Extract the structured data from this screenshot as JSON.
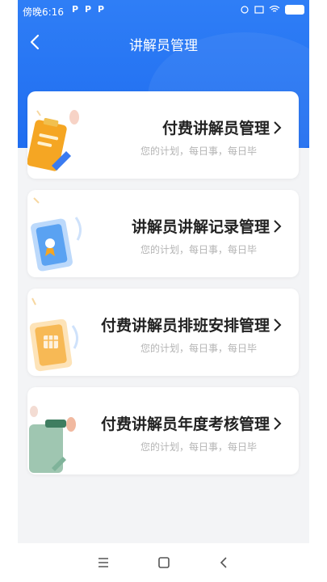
{
  "status_bar": {
    "time": "傍晚6:16",
    "apps": [
      "P",
      "P",
      "P"
    ]
  },
  "nav": {
    "title": "讲解员管理"
  },
  "cards": [
    {
      "title": "付费讲解员管理",
      "subtitle": "您的计划，每日事，每日毕",
      "icon": "clipboard-icon"
    },
    {
      "title": "讲解员讲解记录管理",
      "subtitle": "您的计划，每日事，每日毕",
      "icon": "phone-certificate-icon"
    },
    {
      "title": "付费讲解员排班安排管理",
      "subtitle": "您的计划，每日事，每日毕",
      "icon": "calendar-phone-icon"
    },
    {
      "title": "付费讲解员年度考核管理",
      "subtitle": "您的计划，每日事，每日毕",
      "icon": "folder-icon"
    }
  ],
  "colors": {
    "header": "#1f6df0",
    "card_title": "#222222",
    "subtitle": "#b4b4b4"
  }
}
